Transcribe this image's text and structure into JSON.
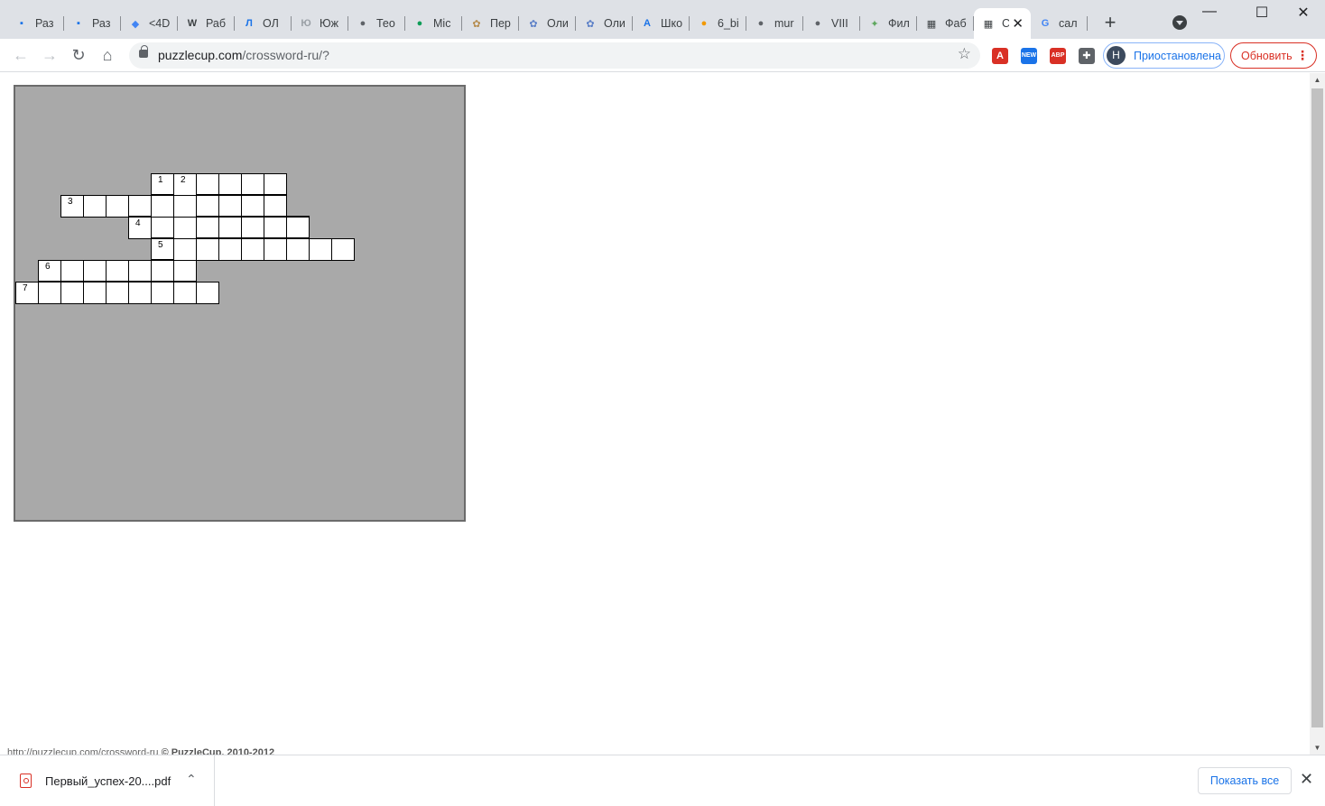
{
  "tabs": [
    {
      "title": "Раз",
      "icon": "square-blue-icon",
      "color": "#1a73e8",
      "glyph": "▪"
    },
    {
      "title": "Раз",
      "icon": "square-blue-icon",
      "color": "#1a73e8",
      "glyph": "▪"
    },
    {
      "title": "<4D",
      "icon": "diamond-icon",
      "color": "#4285f4",
      "glyph": "◆"
    },
    {
      "title": "Раб",
      "icon": "wordpress-icon",
      "color": "#3c4043",
      "glyph": "W"
    },
    {
      "title": "ОЛ",
      "icon": "letter-l-icon",
      "color": "#1a73e8",
      "glyph": "Л"
    },
    {
      "title": "Юж",
      "icon": "logo-icon",
      "color": "#9aa0a6",
      "glyph": "Ю"
    },
    {
      "title": "Тео",
      "icon": "globe-icon",
      "color": "#5f6368",
      "glyph": "●"
    },
    {
      "title": "Mic",
      "icon": "green-logo-icon",
      "color": "#0f9d58",
      "glyph": "●"
    },
    {
      "title": "Пер",
      "icon": "emblem-icon",
      "color": "#b58b4c",
      "glyph": "✿"
    },
    {
      "title": "Оли",
      "icon": "emblem-blue-icon",
      "color": "#5b7fc7",
      "glyph": "✿"
    },
    {
      "title": "Оли",
      "icon": "emblem-blue-icon",
      "color": "#5b7fc7",
      "glyph": "✿"
    },
    {
      "title": "Шко",
      "icon": "letter-a-icon",
      "color": "#1a73e8",
      "glyph": "A"
    },
    {
      "title": "6_bi",
      "icon": "orange-circle-icon",
      "color": "#f29900",
      "glyph": "●"
    },
    {
      "title": "mur",
      "icon": "globe-icon",
      "color": "#5f6368",
      "glyph": "●"
    },
    {
      "title": "VIII",
      "icon": "globe-icon",
      "color": "#5f6368",
      "glyph": "●"
    },
    {
      "title": "Фил",
      "icon": "bird-icon",
      "color": "#5fa85f",
      "glyph": "✦"
    },
    {
      "title": "Фаб",
      "icon": "crossword-icon",
      "color": "#3c4043",
      "glyph": "▦"
    },
    {
      "title": "C",
      "icon": "crossword-icon",
      "color": "#3c4043",
      "glyph": "▦",
      "active": true
    },
    {
      "title": "сал",
      "icon": "google-icon",
      "color": "#4285f4",
      "glyph": "G"
    }
  ],
  "toolbar": {
    "url_host": "puzzlecup.com",
    "url_path": "/crossword-ru/?",
    "profile_initial": "Н",
    "profile_label": "Приостановлена",
    "update_label": "Обновить"
  },
  "extensions": [
    {
      "name": "acrobat-icon",
      "color": "#d93025",
      "glyph": "A"
    },
    {
      "name": "new-badge-icon",
      "color": "#1a73e8",
      "glyph": "NEW"
    },
    {
      "name": "adblock-icon",
      "color": "#d93025",
      "glyph": "ABP"
    },
    {
      "name": "puzzle-extensions-icon",
      "color": "#5f6368",
      "glyph": "✚"
    }
  ],
  "crossword": {
    "numbers": [
      "1",
      "2",
      "3",
      "4",
      "5",
      "6",
      "7"
    ]
  },
  "footer": {
    "link": "http://puzzlecup.com/crossword-ru",
    "copyright": "© PuzzleCup, 2010-2012"
  },
  "download": {
    "filename": "Первый_успех-20....pdf",
    "show_all": "Показать все"
  }
}
